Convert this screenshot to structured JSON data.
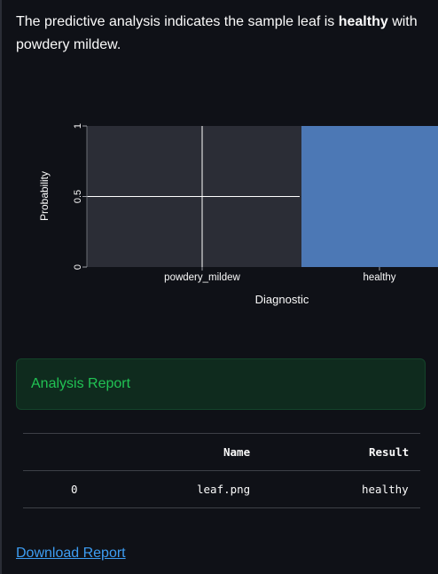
{
  "intro": {
    "prefix": "The predictive analysis indicates the sample leaf is ",
    "diagnosis": "healthy",
    "suffix": " with powdery mildew."
  },
  "chart_data": {
    "type": "bar",
    "categories": [
      "powdery_mildew",
      "healthy"
    ],
    "values": [
      0,
      1
    ],
    "xlabel": "Diagnostic",
    "ylabel": "Probability",
    "ylim": [
      0,
      1
    ],
    "yticks": [
      "0",
      "0.5",
      "1"
    ],
    "grid": true,
    "colors": {
      "bar": "#4c78b5",
      "plot_bg": "#2b2d36",
      "grid": "#ffffff"
    }
  },
  "report": {
    "title": "Analysis Report"
  },
  "table": {
    "columns": [
      "",
      "Name",
      "Result"
    ],
    "rows": [
      {
        "index": "0",
        "name": "leaf.png",
        "result": "healthy"
      }
    ]
  },
  "download": {
    "label": "Download Report"
  }
}
